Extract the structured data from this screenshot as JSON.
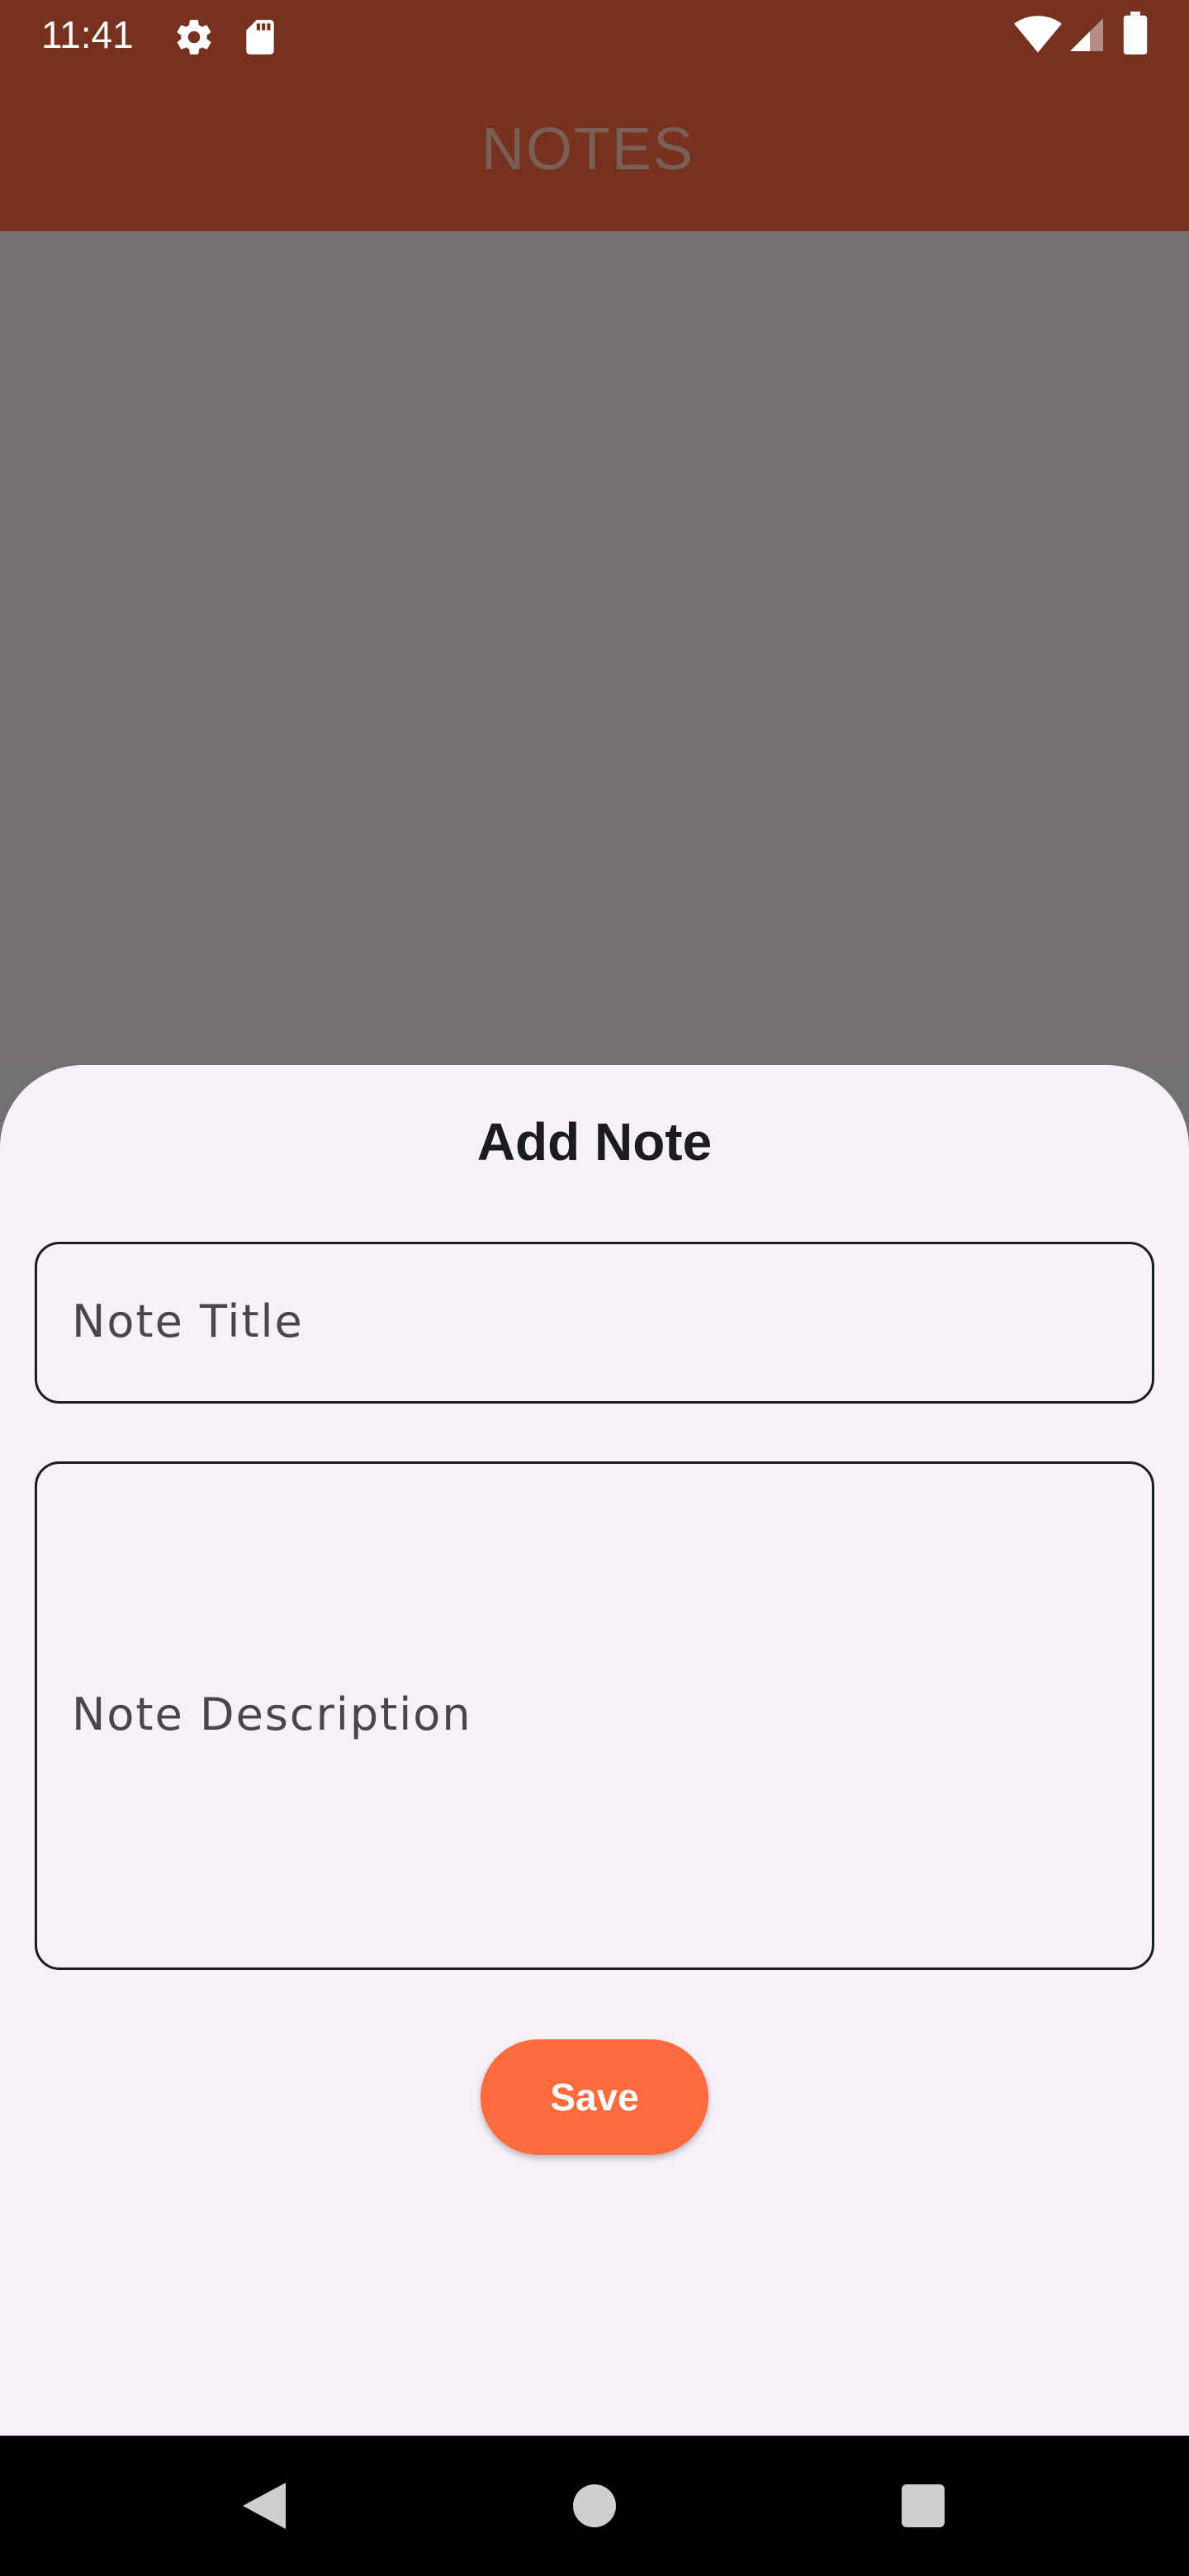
{
  "status_bar": {
    "time": "11:41",
    "icons": [
      "settings-icon",
      "sd-card-icon",
      "wifi-icon",
      "signal-icon",
      "battery-icon"
    ]
  },
  "app_bar": {
    "title": "NOTES"
  },
  "sheet": {
    "title": "Add Note",
    "note_title": {
      "placeholder": "Note Title",
      "value": ""
    },
    "note_description": {
      "placeholder": "Note Description",
      "value": ""
    },
    "save_label": "Save"
  },
  "nav_bar": {
    "buttons": [
      "back-icon",
      "home-icon",
      "recents-icon"
    ]
  },
  "colors": {
    "app_bar": "#77321f",
    "scrim": "#747074",
    "sheet_background": "#f6f1f8",
    "save_button": "#ff6b3d"
  }
}
